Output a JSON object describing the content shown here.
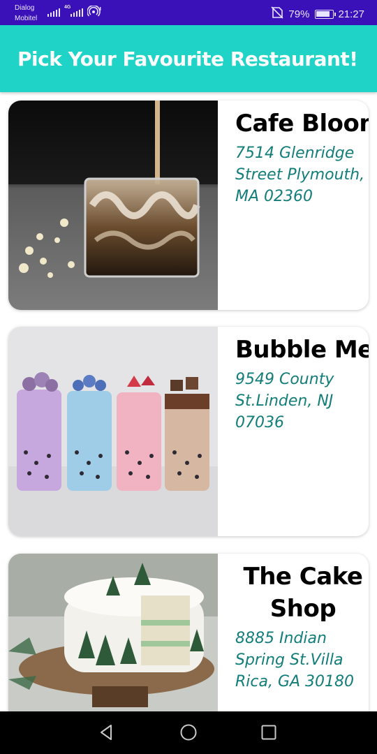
{
  "status_bar": {
    "carrier_line1": "Dialog",
    "carrier_line2": "Mobitel",
    "network_type": "4G",
    "battery_percent": "79%",
    "time": "21:27",
    "icons": [
      "signal-icon",
      "signal-icon",
      "hotspot-icon",
      "no-sim-icon",
      "battery-charging-icon"
    ]
  },
  "app_bar": {
    "title": "Pick Your Favourite Restaurant!",
    "color": "#1fd3c6"
  },
  "restaurants": [
    {
      "name": "Cafe Bloom",
      "address": "7514 Glenridge Street Plymouth, MA 02360",
      "image": "iced-coffee-glass-image"
    },
    {
      "name": "Bubble Me",
      "address": "9549 County St.Linden, NJ 07036",
      "image": "bubble-tea-drinks-image"
    },
    {
      "name": "The Cake Shop",
      "address": "8885 Indian Spring St.Villa Rica, GA 30180",
      "image": "christmas-cake-image"
    }
  ],
  "theme": {
    "status_bar_color": "#3a10b8",
    "address_color": "#127d79"
  },
  "nav_bar": {
    "icons": [
      "back-icon",
      "home-icon",
      "recent-apps-icon"
    ]
  }
}
